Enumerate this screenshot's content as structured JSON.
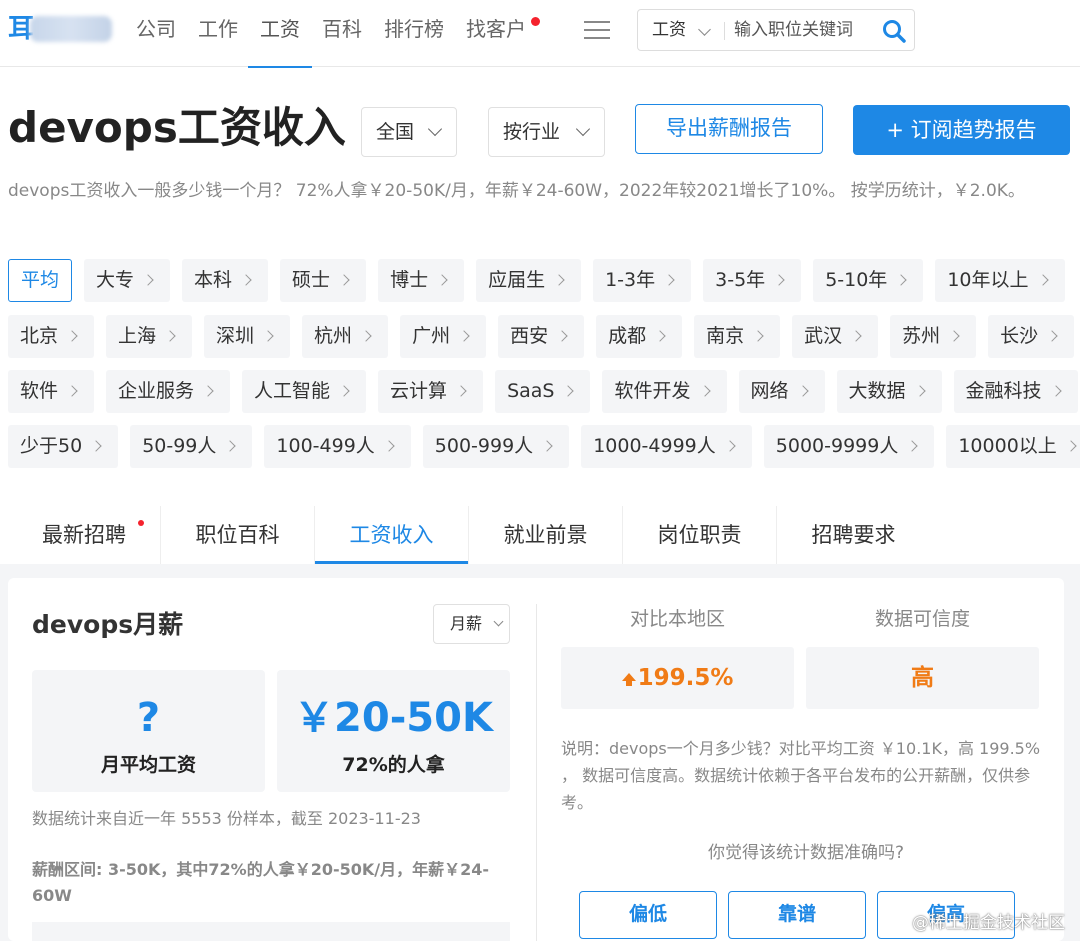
{
  "header": {
    "logo_mark": "耳",
    "nav": [
      "公司",
      "工作",
      "工资",
      "百科",
      "排行榜",
      "找客户"
    ],
    "active_nav": "工资",
    "search": {
      "category": "工资",
      "placeholder": "输入职位关键词"
    }
  },
  "title_row": {
    "title": "devops工资收入",
    "region": "全国",
    "industry": "按行业",
    "export_button": "导出薪酬报告",
    "subscribe_button": "+ 订阅趋势报告"
  },
  "summary": "devops工资收入一般多少钱一个月？ 72%人拿￥20-50K/月，年薪￥24-60W，2022年较2021增长了10%。 按学历统计，￥2.0K。",
  "filters": {
    "education_experience": [
      "平均",
      "大专",
      "本科",
      "硕士",
      "博士",
      "应届生",
      "1-3年",
      "3-5年",
      "5-10年",
      "10年以上"
    ],
    "cities": [
      "北京",
      "上海",
      "深圳",
      "杭州",
      "广州",
      "西安",
      "成都",
      "南京",
      "武汉",
      "苏州",
      "长沙"
    ],
    "industries": [
      "软件",
      "企业服务",
      "人工智能",
      "云计算",
      "SaaS",
      "软件开发",
      "网络",
      "大数据",
      "金融科技"
    ],
    "company_size": [
      "少于50",
      "50-99人",
      "100-499人",
      "500-999人",
      "1000-4999人",
      "5000-9999人",
      "10000以上"
    ]
  },
  "tabs": [
    "最新招聘",
    "职位百科",
    "工资收入",
    "就业前景",
    "岗位职责",
    "招聘要求"
  ],
  "active_tab": "工资收入",
  "salary_card": {
    "title": "devops月薪",
    "period": "月薪",
    "avg_value": "?",
    "avg_label": "月平均工资",
    "range_value": "￥20-50K",
    "range_label": "72%的人拿",
    "meta": "数据统计来自近一年 5553 份样本，截至 2023-11-23",
    "range_text": "薪酬区间: 3-50K，其中72%的人拿￥20-50K/月，年薪￥24-60W"
  },
  "comparison": {
    "local_label": "对比本地区",
    "local_value": "199.5%",
    "credibility_label": "数据可信度",
    "credibility_value": "高",
    "note": "说明：devops一个月多少钱？对比平均工资 ￥10.1K，高 199.5% ， 数据可信度高。数据统计依赖于各平台发布的公开薪酬，仅供参考。",
    "question": "你觉得该统计数据准确吗?",
    "votes": [
      "偏低",
      "靠谱",
      "偏高"
    ]
  },
  "watermark": "@稀土掘金技术社区",
  "colors": {
    "accent": "#1e88e5",
    "orange": "#f07b16",
    "badge": "#f5222d",
    "panel_bg": "#f4f5f7"
  }
}
